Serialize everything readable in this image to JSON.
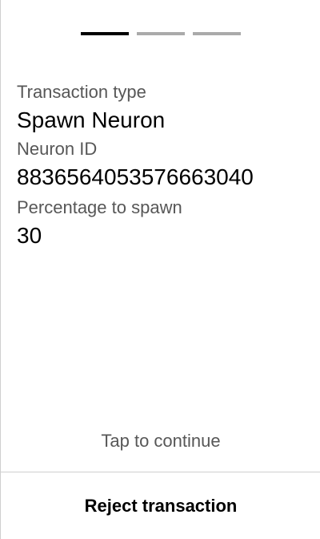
{
  "progress": {
    "total_steps": 3,
    "current_step": 1,
    "active_color": "#000000",
    "inactive_color": "#aaaaaa"
  },
  "fields": [
    {
      "label": "Transaction type",
      "value": "Spawn Neuron"
    },
    {
      "label": "Neuron ID",
      "value": "8836564053576663040"
    },
    {
      "label": "Percentage to spawn",
      "value": "30"
    }
  ],
  "tap_hint": "Tap to continue",
  "reject_button": {
    "label": "Reject transaction"
  },
  "colors": {
    "background": "#ffffff",
    "text_primary": "#000000",
    "text_secondary": "#575757",
    "divider": "#cfcfcf"
  }
}
